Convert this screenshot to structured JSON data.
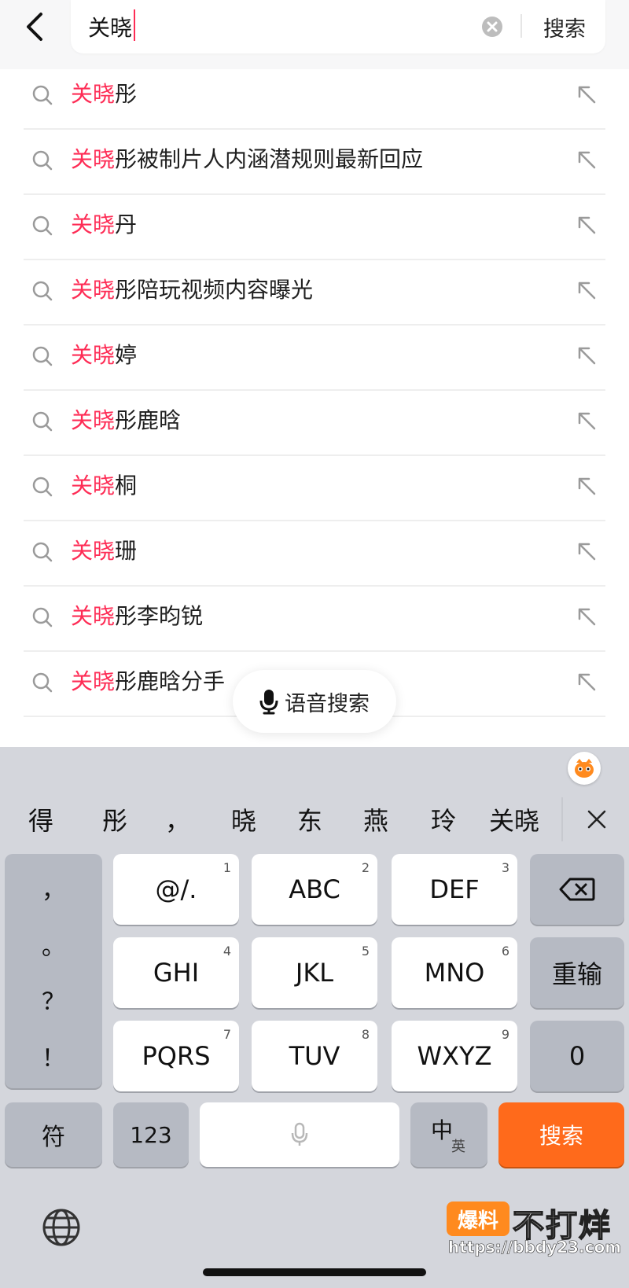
{
  "search": {
    "query": "关晓",
    "button_label": "搜索"
  },
  "suggestions": [
    {
      "highlight": "关晓",
      "rest": "彤"
    },
    {
      "highlight": "关晓",
      "rest": "彤被制片人内涵潜规则最新回应"
    },
    {
      "highlight": "关晓",
      "rest": "丹"
    },
    {
      "highlight": "关晓",
      "rest": "彤陪玩视频内容曝光"
    },
    {
      "highlight": "关晓",
      "rest": "婷"
    },
    {
      "highlight": "关晓",
      "rest": "彤鹿晗"
    },
    {
      "highlight": "关晓",
      "rest": "桐"
    },
    {
      "highlight": "关晓",
      "rest": "珊"
    },
    {
      "highlight": "关晓",
      "rest": "彤李昀锐"
    },
    {
      "highlight": "关晓",
      "rest": "彤鹿晗分手"
    }
  ],
  "voice_search": {
    "label": "语音搜索"
  },
  "keyboard": {
    "candidates": [
      "得",
      "彤",
      "，",
      "晓",
      "东",
      "燕",
      "玲",
      "关晓"
    ],
    "punctuation": [
      "，",
      "。",
      "？",
      "！"
    ],
    "keys": {
      "k1": {
        "label": "@/.",
        "num": "1"
      },
      "k2": {
        "label": "ABC",
        "num": "2"
      },
      "k3": {
        "label": "DEF",
        "num": "3"
      },
      "k4": {
        "label": "GHI",
        "num": "4"
      },
      "k5": {
        "label": "JKL",
        "num": "5"
      },
      "k6": {
        "label": "MNO",
        "num": "6"
      },
      "k7": {
        "label": "PQRS",
        "num": "7"
      },
      "k8": {
        "label": "TUV",
        "num": "8"
      },
      "k9": {
        "label": "WXYZ",
        "num": "9"
      }
    },
    "retype_label": "重输",
    "zero_label": "0",
    "symbol_label": "符",
    "numeric_label": "123",
    "lang_primary": "中",
    "lang_secondary": "英",
    "action_label": "搜索",
    "action_color": "#ff6a1b"
  },
  "watermark": {
    "logo_text": "爆料",
    "brand_text": "不打烊",
    "url": "https://bbdy23.com"
  },
  "colors": {
    "highlight": "#fe2c55"
  }
}
